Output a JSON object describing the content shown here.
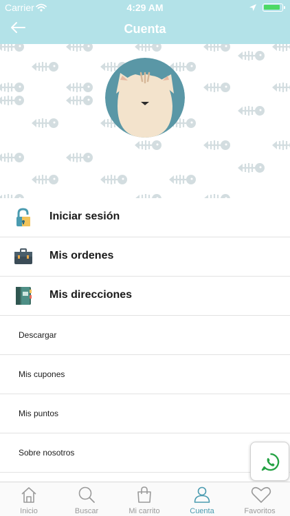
{
  "status_bar": {
    "carrier": "Carrier",
    "time": "4:29 AM",
    "battery_color": "#4cd964"
  },
  "header": {
    "title": "Cuenta",
    "background": "#b3e2e8",
    "back_icon": "arrow-left-icon"
  },
  "banner": {
    "pattern_icon": "fish-bone-icon",
    "avatar_icon": "cat-face-icon"
  },
  "menu": {
    "primary": [
      {
        "label": "Iniciar sesión",
        "icon": "padlock-icon"
      },
      {
        "label": "Mis ordenes",
        "icon": "briefcase-icon"
      },
      {
        "label": "Mis direcciones",
        "icon": "address-book-icon"
      }
    ],
    "secondary": [
      {
        "label": "Descargar"
      },
      {
        "label": "Mis cupones"
      },
      {
        "label": "Mis puntos"
      },
      {
        "label": "Sobre nosotros"
      }
    ]
  },
  "whatsapp": {
    "icon": "whatsapp-icon",
    "color": "#25a244"
  },
  "tabbar": {
    "active_color": "#4a9bb0",
    "tabs": [
      {
        "label": "Inicio",
        "icon": "home-icon",
        "active": false
      },
      {
        "label": "Buscar",
        "icon": "search-icon",
        "active": false
      },
      {
        "label": "Mi carrito",
        "icon": "shopping-bag-icon",
        "active": false
      },
      {
        "label": "Cuenta",
        "icon": "user-icon",
        "active": true
      },
      {
        "label": "Favoritos",
        "icon": "heart-icon",
        "active": false
      }
    ]
  }
}
